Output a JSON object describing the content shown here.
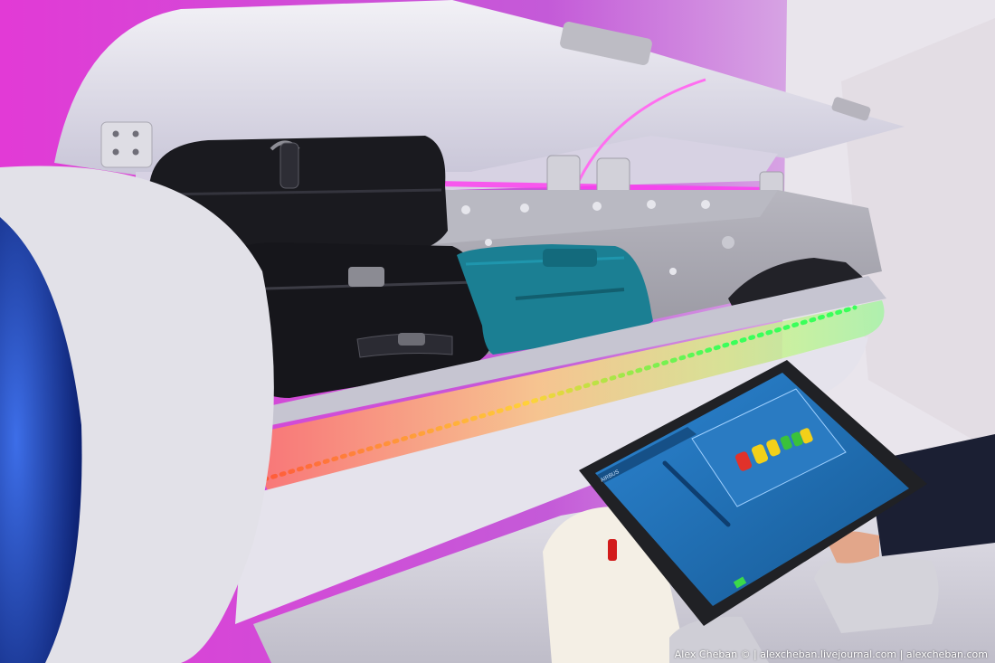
{
  "watermark": "Alex Cheban © | alexcheban.livejournal.com | alexcheban.com",
  "tablet_screen": {
    "brand": "AIRBUS"
  },
  "colors": {
    "ambient_light": "#e040d8",
    "led_red": "#ff5a3a",
    "led_yellow": "#ffd23a",
    "led_green": "#3aff5a",
    "tablet_screen": "#1f6fb5",
    "window_blue": "#1e3fa8"
  },
  "icons": {
    "bin_hinge": "hinge-icon",
    "tablet_status": "status-indicator-icon"
  }
}
